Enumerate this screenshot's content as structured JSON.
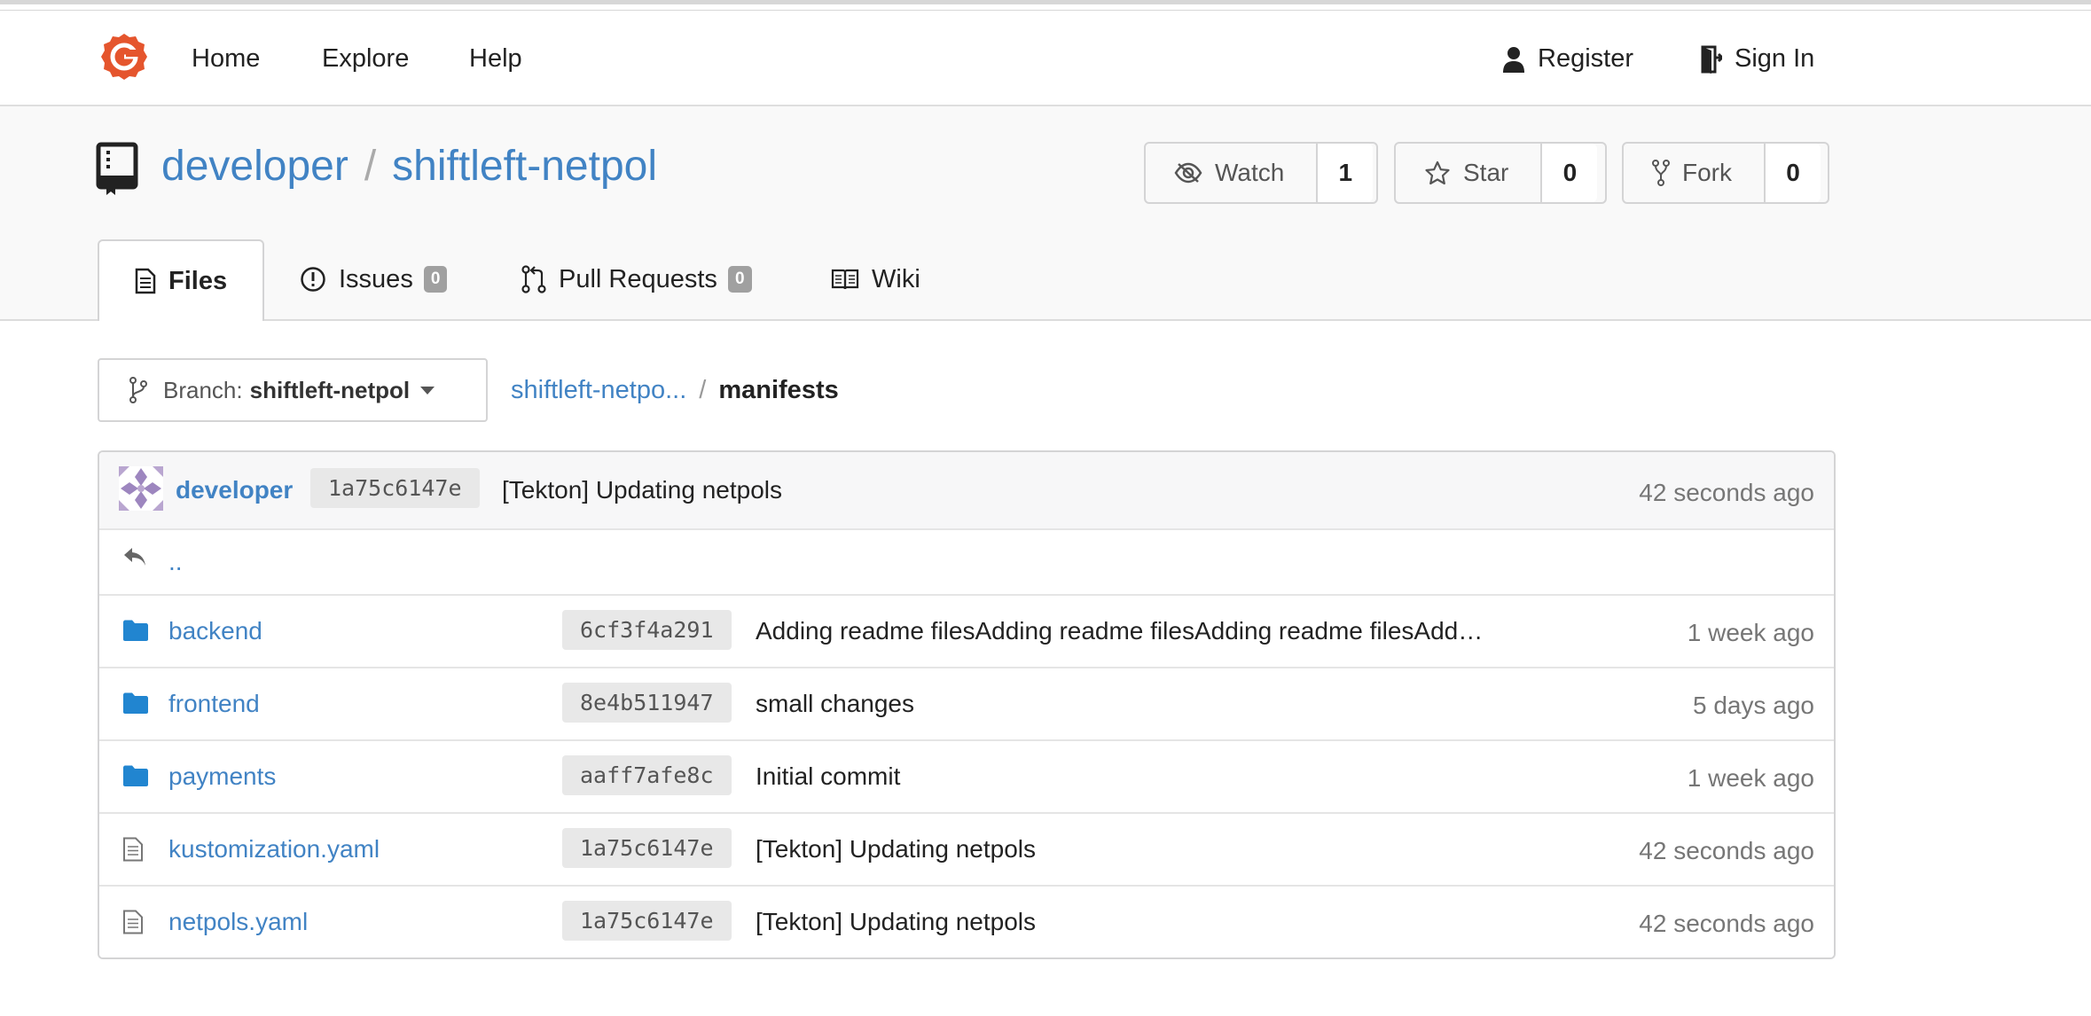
{
  "nav": {
    "home": "Home",
    "explore": "Explore",
    "help": "Help",
    "register": "Register",
    "sign_in": "Sign In"
  },
  "repo": {
    "owner": "developer",
    "separator": "/",
    "name": "shiftleft-netpol"
  },
  "actions": {
    "watch_label": "Watch",
    "watch_count": "1",
    "star_label": "Star",
    "star_count": "0",
    "fork_label": "Fork",
    "fork_count": "0"
  },
  "tabs": [
    {
      "label": "Files"
    },
    {
      "label": "Issues",
      "badge": "0"
    },
    {
      "label": "Pull Requests",
      "badge": "0"
    },
    {
      "label": "Wiki"
    }
  ],
  "branch": {
    "prefix": "Branch:",
    "name": "shiftleft-netpol"
  },
  "breadcrumb": {
    "root": "shiftleft-netpo...",
    "separator": "/",
    "current": "manifests"
  },
  "latest_commit": {
    "author": "developer",
    "sha": "1a75c6147e",
    "message": "[Tekton] Updating netpols",
    "time": "42 seconds ago"
  },
  "parent_link": "..",
  "files": [
    {
      "name": "backend",
      "type": "folder",
      "sha": "6cf3f4a291",
      "message": "Adding readme filesAdding readme filesAdding readme filesAdd…",
      "time": "1 week ago"
    },
    {
      "name": "frontend",
      "type": "folder",
      "sha": "8e4b511947",
      "message": "small changes",
      "time": "5 days ago"
    },
    {
      "name": "payments",
      "type": "folder",
      "sha": "aaff7afe8c",
      "message": "Initial commit",
      "time": "1 week ago"
    },
    {
      "name": "kustomization.yaml",
      "type": "file",
      "sha": "1a75c6147e",
      "message": "[Tekton] Updating netpols",
      "time": "42 seconds ago"
    },
    {
      "name": "netpols.yaml",
      "type": "file",
      "sha": "1a75c6147e",
      "message": "[Tekton] Updating netpols",
      "time": "42 seconds ago"
    }
  ],
  "colors": {
    "link": "#4183c4",
    "folder": "#2185d0",
    "logo": "#e5552d"
  }
}
